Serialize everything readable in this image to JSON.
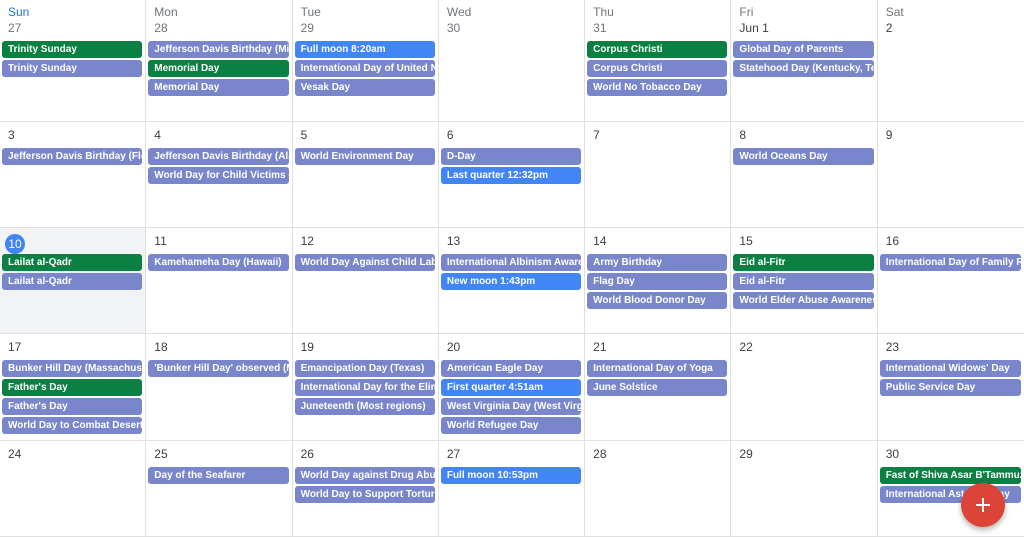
{
  "colors": {
    "green": "#0b8043",
    "lavender": "#7986cb",
    "blue": "#4285f4",
    "today": "#4285f4",
    "fab": "#db4437"
  },
  "weekdays": [
    "Sun",
    "Mon",
    "Tue",
    "Wed",
    "Thu",
    "Fri",
    "Sat"
  ],
  "weeks": [
    [
      {
        "day": "27",
        "events": [
          {
            "title": "Trinity Sunday",
            "color": "green"
          },
          {
            "title": "Trinity Sunday",
            "color": "lavender"
          }
        ]
      },
      {
        "day": "28",
        "events": [
          {
            "title": "Jefferson Davis Birthday (Mississippi)",
            "color": "lavender"
          },
          {
            "title": "Memorial Day",
            "color": "green"
          },
          {
            "title": "Memorial Day",
            "color": "lavender"
          }
        ]
      },
      {
        "day": "29",
        "events": [
          {
            "title": "Full moon 8:20am",
            "color": "blue"
          },
          {
            "title": "International Day of United Nations Peacekeepers",
            "color": "lavender"
          },
          {
            "title": "Vesak Day",
            "color": "lavender"
          }
        ]
      },
      {
        "day": "30",
        "events": []
      },
      {
        "day": "31",
        "events": [
          {
            "title": "Corpus Christi",
            "color": "green"
          },
          {
            "title": "Corpus Christi",
            "color": "lavender"
          },
          {
            "title": "World No Tobacco Day",
            "color": "lavender"
          }
        ]
      },
      {
        "day": "Jun 1",
        "in_month": true,
        "events": [
          {
            "title": "Global Day of Parents",
            "color": "lavender"
          },
          {
            "title": "Statehood Day (Kentucky, Tennessee)",
            "color": "lavender"
          }
        ]
      },
      {
        "day": "2",
        "in_month": true,
        "events": []
      }
    ],
    [
      {
        "day": "3",
        "events": [
          {
            "title": "Jefferson Davis Birthday (Florida)",
            "color": "lavender"
          }
        ]
      },
      {
        "day": "4",
        "events": [
          {
            "title": "Jefferson Davis Birthday (Alabama)",
            "color": "lavender"
          },
          {
            "title": "World Day for Child Victims of Aggression",
            "color": "lavender"
          }
        ]
      },
      {
        "day": "5",
        "events": [
          {
            "title": "World Environment Day",
            "color": "lavender"
          }
        ]
      },
      {
        "day": "6",
        "events": [
          {
            "title": "D-Day",
            "color": "lavender"
          },
          {
            "title": "Last quarter 12:32pm",
            "color": "blue"
          }
        ]
      },
      {
        "day": "7",
        "events": []
      },
      {
        "day": "8",
        "events": [
          {
            "title": "World Oceans Day",
            "color": "lavender"
          }
        ]
      },
      {
        "day": "9",
        "events": []
      }
    ],
    [
      {
        "day": "10",
        "today": true,
        "events": [
          {
            "title": "Lailat al-Qadr",
            "color": "green"
          },
          {
            "title": "Lailat al-Qadr",
            "color": "lavender"
          }
        ]
      },
      {
        "day": "11",
        "events": [
          {
            "title": "Kamehameha Day (Hawaii)",
            "color": "lavender"
          }
        ]
      },
      {
        "day": "12",
        "events": [
          {
            "title": "World Day Against Child Labour",
            "color": "lavender"
          }
        ]
      },
      {
        "day": "13",
        "events": [
          {
            "title": "International Albinism Awareness Day",
            "color": "lavender"
          },
          {
            "title": "New moon 1:43pm",
            "color": "blue"
          }
        ]
      },
      {
        "day": "14",
        "events": [
          {
            "title": "Army Birthday",
            "color": "lavender"
          },
          {
            "title": "Flag Day",
            "color": "lavender"
          },
          {
            "title": "World Blood Donor Day",
            "color": "lavender"
          }
        ]
      },
      {
        "day": "15",
        "events": [
          {
            "title": "Eid al-Fitr",
            "color": "green"
          },
          {
            "title": "Eid al-Fitr",
            "color": "lavender"
          },
          {
            "title": "World Elder Abuse Awareness Day",
            "color": "lavender"
          }
        ]
      },
      {
        "day": "16",
        "events": [
          {
            "title": "International Day of Family Remittances",
            "color": "lavender"
          }
        ]
      }
    ],
    [
      {
        "day": "17",
        "events": [
          {
            "title": "Bunker Hill Day (Massachusetts)",
            "color": "lavender"
          },
          {
            "title": "Father's Day",
            "color": "green"
          },
          {
            "title": "Father's Day",
            "color": "lavender"
          },
          {
            "title": "World Day to Combat Desertification",
            "color": "lavender"
          }
        ]
      },
      {
        "day": "18",
        "events": [
          {
            "title": "'Bunker Hill Day' observed (Massachusetts)",
            "color": "lavender"
          }
        ]
      },
      {
        "day": "19",
        "events": [
          {
            "title": "Emancipation Day (Texas)",
            "color": "lavender"
          },
          {
            "title": "International Day for the Elimination of Sexual Violence in Conflict",
            "color": "lavender"
          },
          {
            "title": "Juneteenth (Most regions)",
            "color": "lavender"
          }
        ]
      },
      {
        "day": "20",
        "events": [
          {
            "title": "American Eagle Day",
            "color": "lavender"
          },
          {
            "title": "First quarter 4:51am",
            "color": "blue"
          },
          {
            "title": "West Virginia Day (West Virginia)",
            "color": "lavender"
          },
          {
            "title": "World Refugee Day",
            "color": "lavender"
          }
        ]
      },
      {
        "day": "21",
        "events": [
          {
            "title": "International Day of Yoga",
            "color": "lavender"
          },
          {
            "title": "June Solstice",
            "color": "lavender"
          }
        ]
      },
      {
        "day": "22",
        "events": []
      },
      {
        "day": "23",
        "events": [
          {
            "title": "International Widows' Day",
            "color": "lavender"
          },
          {
            "title": "Public Service Day",
            "color": "lavender"
          }
        ]
      }
    ],
    [
      {
        "day": "24",
        "events": []
      },
      {
        "day": "25",
        "events": [
          {
            "title": "Day of the Seafarer",
            "color": "lavender"
          }
        ]
      },
      {
        "day": "26",
        "events": [
          {
            "title": "World Day against Drug Abuse",
            "color": "lavender"
          },
          {
            "title": "World Day to Support Torture Victims",
            "color": "lavender"
          }
        ]
      },
      {
        "day": "27",
        "events": [
          {
            "title": "Full moon 10:53pm",
            "color": "blue"
          }
        ]
      },
      {
        "day": "28",
        "events": []
      },
      {
        "day": "29",
        "events": []
      },
      {
        "day": "30",
        "events": [
          {
            "title": "Fast of Shiva Asar B'Tammuz",
            "color": "green"
          },
          {
            "title": "International Asteroid Day",
            "color": "lavender"
          }
        ]
      }
    ]
  ],
  "fab": {
    "label": "Create",
    "icon": "plus-icon"
  }
}
